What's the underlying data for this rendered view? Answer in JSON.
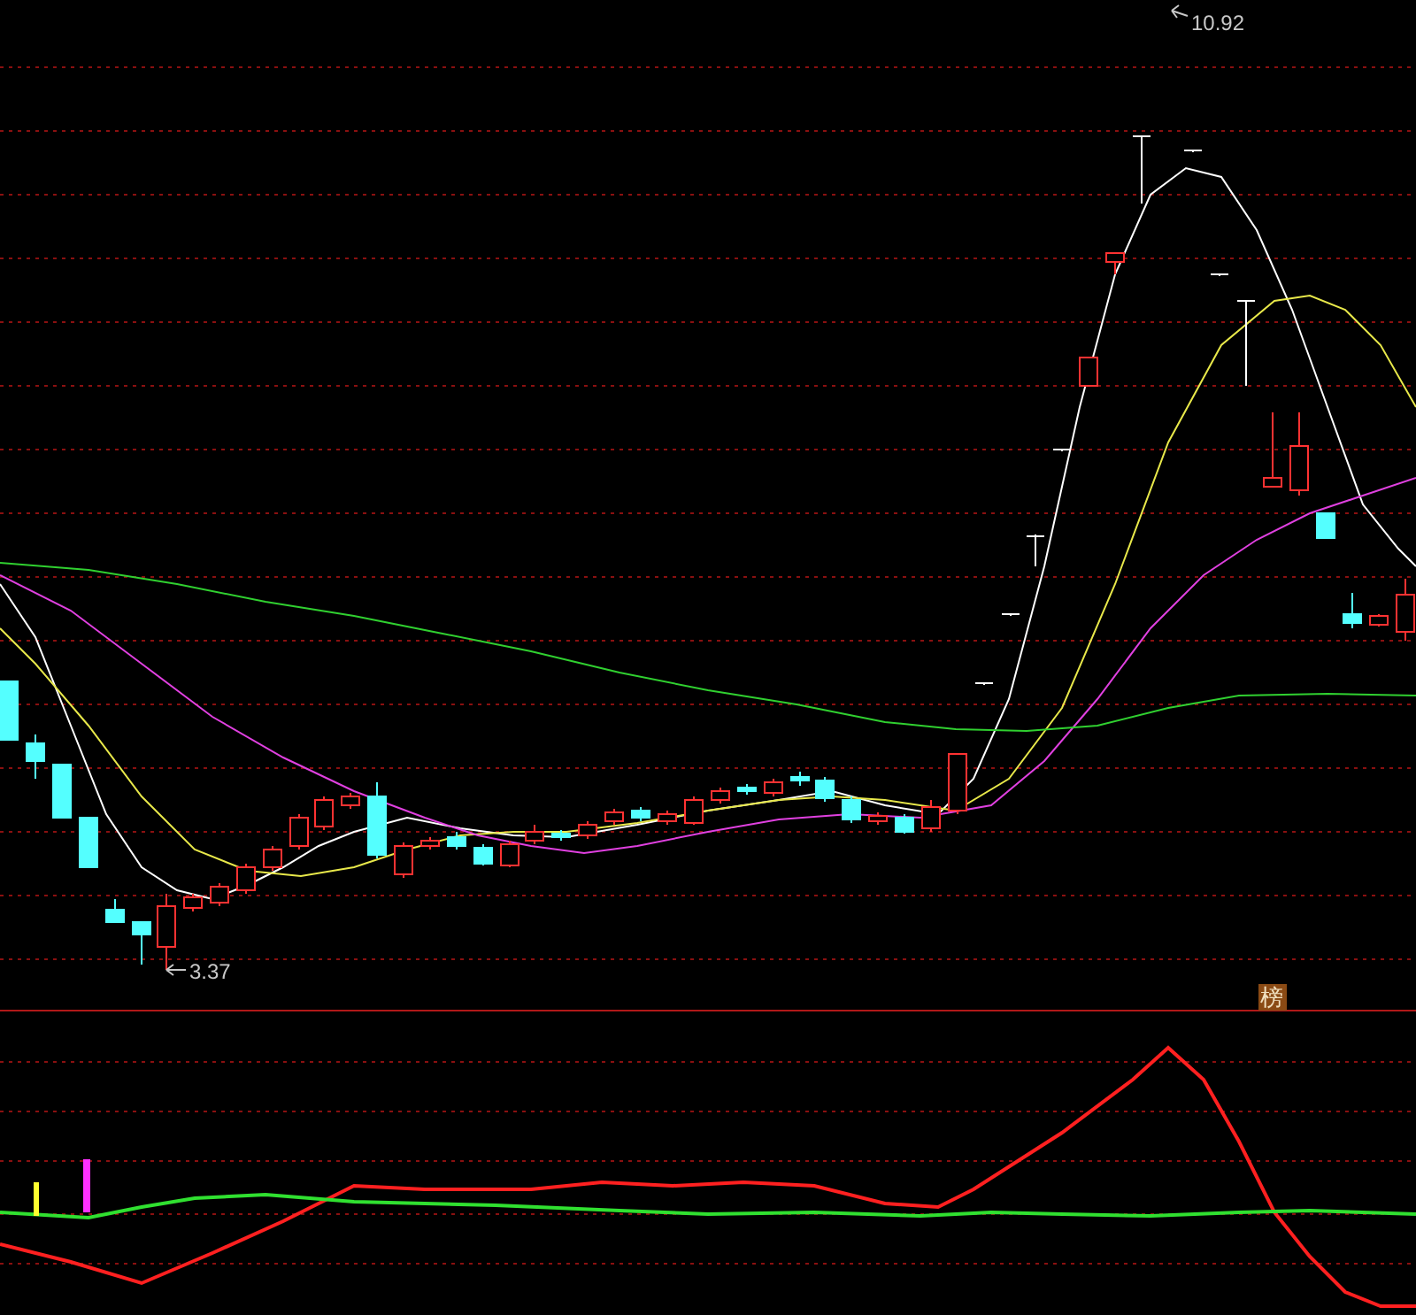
{
  "labels": [
    {
      "kind": "high",
      "text": "10.92"
    },
    {
      "kind": "low",
      "text": "3.37"
    }
  ],
  "badge": {
    "text": "榜"
  }
}
